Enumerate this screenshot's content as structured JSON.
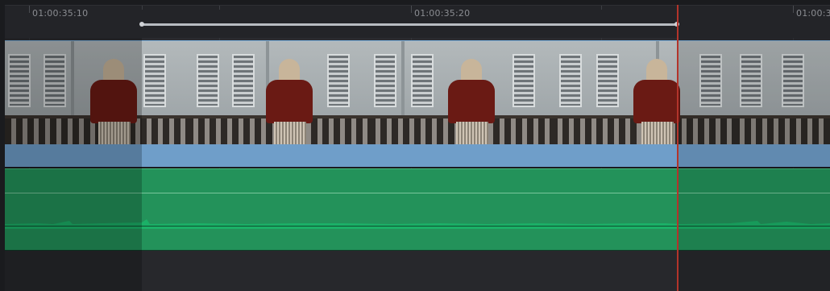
{
  "ruler": {
    "timecodes": [
      {
        "label": "01:00:35:10"
      },
      {
        "label": "01:00:35:20"
      },
      {
        "label": "01:00:3"
      }
    ]
  },
  "tracks": {
    "video": {
      "clip_color": "#6f9ec9"
    },
    "audio": {
      "clip_color": "#23925a"
    }
  },
  "playhead": {
    "color": "#b3342b"
  },
  "colors": {
    "background": "#1a1b1e",
    "ruler": "#232428",
    "range_bar": "#b8bcc2"
  }
}
